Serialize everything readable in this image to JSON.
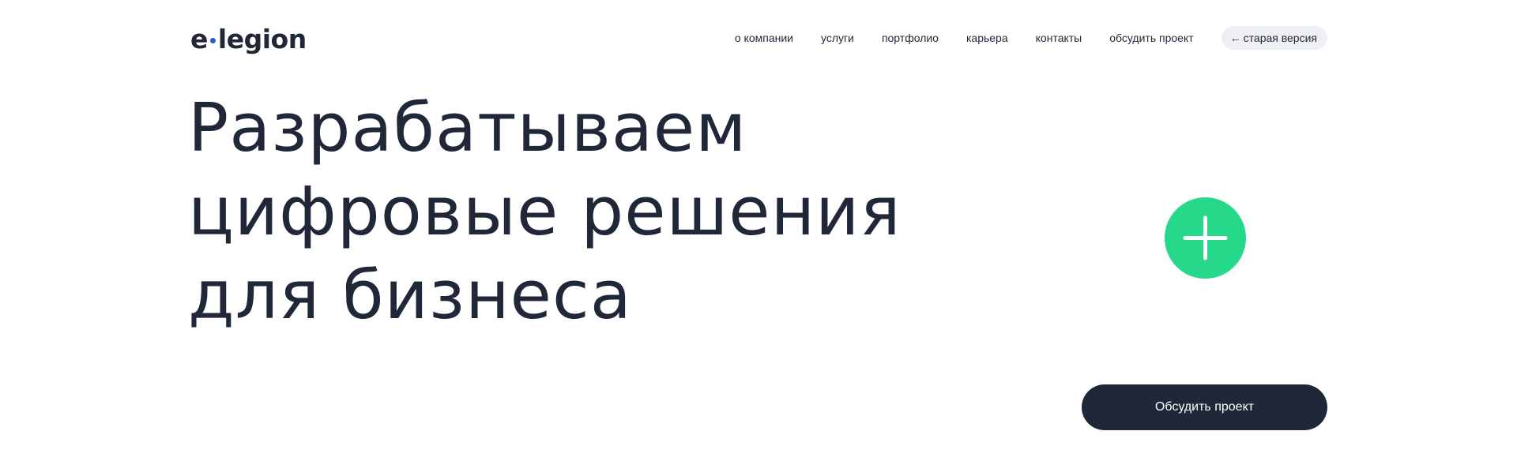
{
  "header": {
    "logo": {
      "left": "e",
      "right": "legion"
    },
    "nav": [
      {
        "label": "о компании"
      },
      {
        "label": "услуги"
      },
      {
        "label": "портфолио"
      },
      {
        "label": "карьера"
      },
      {
        "label": "контакты"
      },
      {
        "label": "обсудить проект"
      }
    ],
    "old_version": {
      "arrow": "←",
      "label": "старая версия"
    }
  },
  "hero": {
    "lines": [
      "Разрабатываем",
      "цифровые решения",
      "для бизнеса"
    ]
  },
  "plus_button": {
    "icon": "plus-icon"
  },
  "cta": {
    "label": "Обсудить проект"
  },
  "colors": {
    "text": "#1f2738",
    "logo_dot": "#2d5bd7",
    "accent_green": "#26d98a",
    "cta_bg": "#1f2738",
    "pill_bg": "#eef0f3"
  }
}
